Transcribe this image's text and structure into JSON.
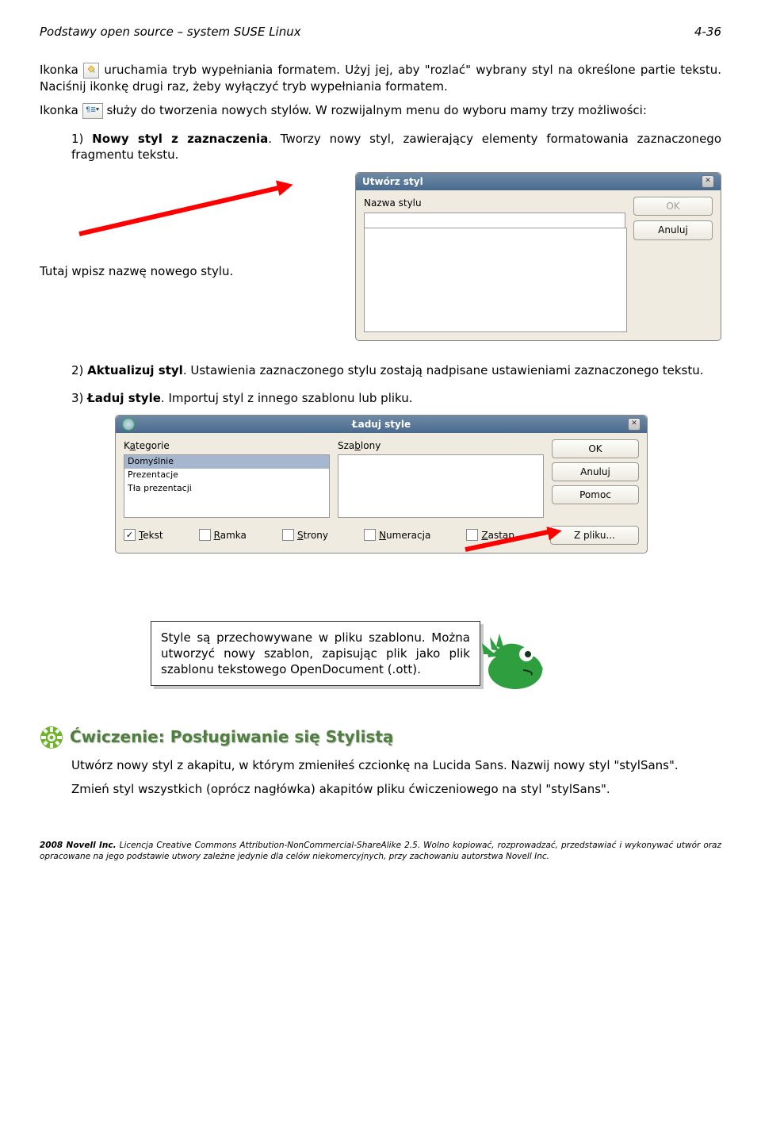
{
  "header": {
    "title": "Podstawy open source – system SUSE Linux",
    "page": "4-36"
  },
  "p1a": "Ikonka ",
  "p1b": " uruchamia tryb wypełniania formatem. Użyj jej, aby \"rozlać\" wybrany styl na określone partie tekstu. Naciśnij ikonkę drugi raz, żeby wyłączyć tryb wypełniania formatem.",
  "p2a": "Ikonka ",
  "p2b": " służy do tworzenia nowych stylów. W rozwijalnym menu do wyboru mamy trzy możliwości:",
  "li1_label": "1) ",
  "li1_bold": "Nowy styl z zaznaczenia",
  "li1_rest": ". Tworzy nowy styl, zawierający elementy formatowania zaznaczonego fragmentu tekstu.",
  "dialog1": {
    "title": "Utwórz styl",
    "label": "Nazwa stylu",
    "ok": "OK",
    "cancel": "Anuluj",
    "input_value": ""
  },
  "caption1": "Tutaj wpisz nazwę nowego stylu.",
  "li2_label": "2) ",
  "li2_bold": "Aktualizuj styl",
  "li2_rest": ". Ustawienia zaznaczonego stylu zostają nadpisane ustawieniami zaznaczonego tekstu.",
  "li3_label": "3) ",
  "li3_bold": "Ładuj style",
  "li3_rest": ". Importuj styl z innego szablonu lub pliku.",
  "dialog2": {
    "title": "Ładuj style",
    "col1_label_pre": "K",
    "col1_label_u": "a",
    "col1_label_post": "tegorie",
    "col1_items": [
      "Domyślnie",
      "Prezentacje",
      "Tła prezentacji"
    ],
    "col2_label_pre": "Sza",
    "col2_label_u": "b",
    "col2_label_post": "lony",
    "ok": "OK",
    "cancel": "Anuluj",
    "help": "Pomoc",
    "chk1_u": "T",
    "chk1_rest": "ekst",
    "chk1_checked": "✓",
    "chk2_u": "R",
    "chk2_rest": "amka",
    "chk3_u": "S",
    "chk3_rest": "trony",
    "chk4_u": "N",
    "chk4_rest": "umeracja",
    "chk5_u": "Z",
    "chk5_rest": "astąp",
    "file_btn": "Z pliku..."
  },
  "note": "Style są przechowywane w pliku szablonu. Można utworzyć nowy szablon, zapisując plik jako plik szablonu tekstowego OpenDocument (.ott).",
  "exercise": {
    "title": "Ćwiczenie: Posługiwanie się Stylistą",
    "p1": "Utwórz nowy styl z akapitu, w którym zmieniłeś czcionkę na Lucida Sans. Nazwij nowy styl \"stylSans\".",
    "p2": "Zmień styl wszystkich (oprócz nagłówka) akapitów pliku ćwiczeniowego na styl \"stylSans\"."
  },
  "footer": "2008 Novell Inc. Licencja Creative Commons Attribution-NonCommercial-ShareAlike 2.5. Wolno kopiować, rozprowadzać, przedstawiać i wykonywać utwór oraz opracowane na jego podstawie utwory zależne jedynie dla celów niekomercyjnych, przy zachowaniu autorstwa Novell Inc.",
  "footer_bold": "2008 Novell Inc."
}
